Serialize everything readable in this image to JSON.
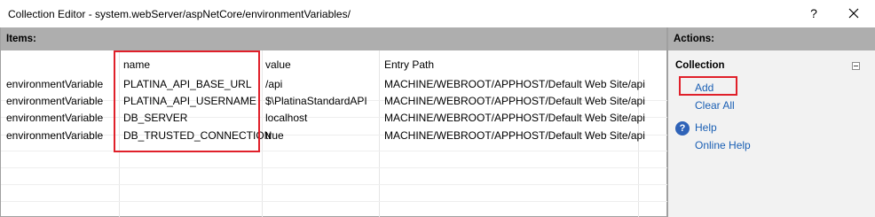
{
  "window": {
    "title": "Collection Editor - system.webServer/aspNetCore/environmentVariables/",
    "help_glyph": "?",
    "close_icon": "close-icon"
  },
  "items_panel": {
    "header": "Items:",
    "columns": [
      "",
      "name",
      "value",
      "Entry Path"
    ],
    "rows": [
      {
        "type": "environmentVariable",
        "name": "PLATINA_API_BASE_URL",
        "value": "/api",
        "entry_path": "MACHINE/WEBROOT/APPHOST/Default Web Site/api"
      },
      {
        "type": "environmentVariable",
        "name": "PLATINA_API_USERNAME",
        "value": "$\\PlatinaStandardAPI",
        "entry_path": "MACHINE/WEBROOT/APPHOST/Default Web Site/api"
      },
      {
        "type": "environmentVariable",
        "name": "DB_SERVER",
        "value": "localhost",
        "entry_path": "MACHINE/WEBROOT/APPHOST/Default Web Site/api"
      },
      {
        "type": "environmentVariable",
        "name": "DB_TRUSTED_CONNECTION",
        "value": "true",
        "entry_path": "MACHINE/WEBROOT/APPHOST/Default Web Site/api"
      }
    ]
  },
  "actions_panel": {
    "header": "Actions:",
    "section_title": "Collection",
    "collection_actions": [
      "Add",
      "Clear All"
    ],
    "help_actions": [
      "Help",
      "Online Help"
    ],
    "help_icon": "help-icon"
  },
  "colors": {
    "highlight": "#e0202a",
    "link": "#1a5fb4",
    "panel_header": "#aeaeae"
  }
}
